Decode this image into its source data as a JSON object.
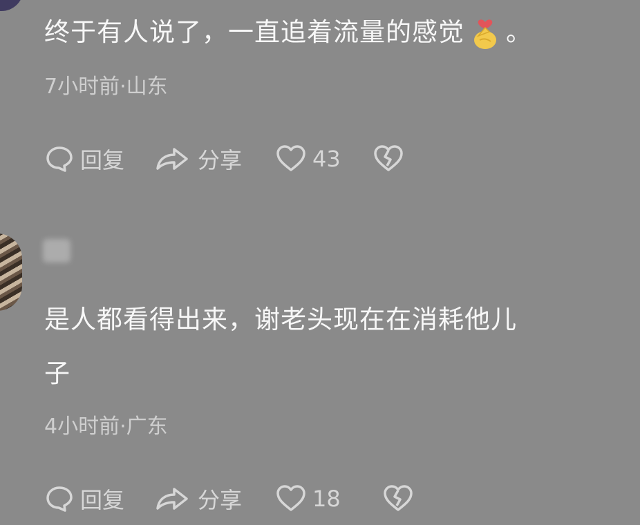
{
  "comments": [
    {
      "text": "终于有人说了，一直追着流量的感觉",
      "trailing": "。",
      "emoji": "finger-heart-icon",
      "meta": "7小时前·山东",
      "reply_label": "回复",
      "share_label": "分享",
      "likes": "43"
    },
    {
      "text_line1": "是人都看得出来，谢老头现在在消耗他儿",
      "text_line2": "子",
      "meta": "4小时前·广东",
      "reply_label": "回复",
      "share_label": "分享",
      "likes": "18"
    }
  ]
}
